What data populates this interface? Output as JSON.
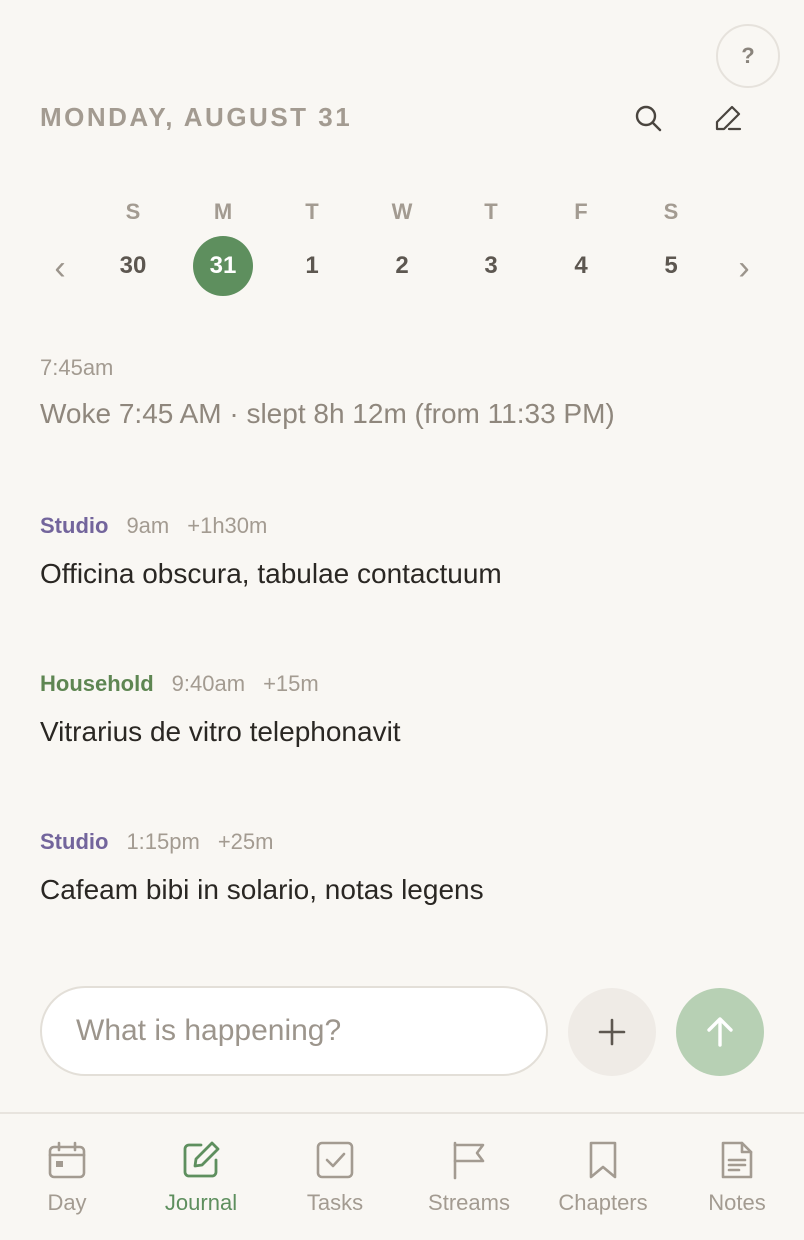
{
  "colors": {
    "background": "#f9f7f3",
    "accent_green": "#5e8f5e",
    "studio_purple": "#73659c",
    "household_green": "#5e8652",
    "muted_text": "#a39b91"
  },
  "header": {
    "help_label": "?",
    "date_title": "MONDAY, AUGUST 31",
    "search_icon": "search-icon",
    "edit_icon": "pencil-icon"
  },
  "calendar": {
    "prev_label": "‹",
    "next_label": "›",
    "weekdays": [
      "S",
      "M",
      "T",
      "W",
      "T",
      "F",
      "S"
    ],
    "days": [
      "30",
      "31",
      "1",
      "2",
      "3",
      "4",
      "5"
    ],
    "selected_index": 1
  },
  "entries": [
    {
      "tag": "",
      "tag_color": "",
      "time": "7:45am",
      "duration": "",
      "text": "Woke 7:45 AM · slept 8h 12m (from 11:33 PM)",
      "muted": true
    },
    {
      "tag": "Studio",
      "tag_color": "#73659c",
      "time": "9am",
      "duration": "+1h30m",
      "text": "Officina obscura, tabulae contactuum",
      "muted": false
    },
    {
      "tag": "Household",
      "tag_color": "#5e8652",
      "time": "9:40am",
      "duration": "+15m",
      "text": "Vitrarius de vitro telephonavit",
      "muted": false
    },
    {
      "tag": "Studio",
      "tag_color": "#73659c",
      "time": "1:15pm",
      "duration": "+25m",
      "text": "Cafeam bibi in solario, notas legens",
      "muted": false
    }
  ],
  "composer": {
    "placeholder": "What is happening?",
    "add_icon": "plus-icon",
    "send_icon": "arrow-up-icon"
  },
  "tabs": [
    {
      "label": "Day",
      "icon": "calendar-icon",
      "active": false
    },
    {
      "label": "Journal",
      "icon": "pencil-square-icon",
      "active": true
    },
    {
      "label": "Tasks",
      "icon": "checkbox-icon",
      "active": false
    },
    {
      "label": "Streams",
      "icon": "flag-icon",
      "active": false
    },
    {
      "label": "Chapters",
      "icon": "bookmark-icon",
      "active": false
    },
    {
      "label": "Notes",
      "icon": "document-icon",
      "active": false
    }
  ]
}
